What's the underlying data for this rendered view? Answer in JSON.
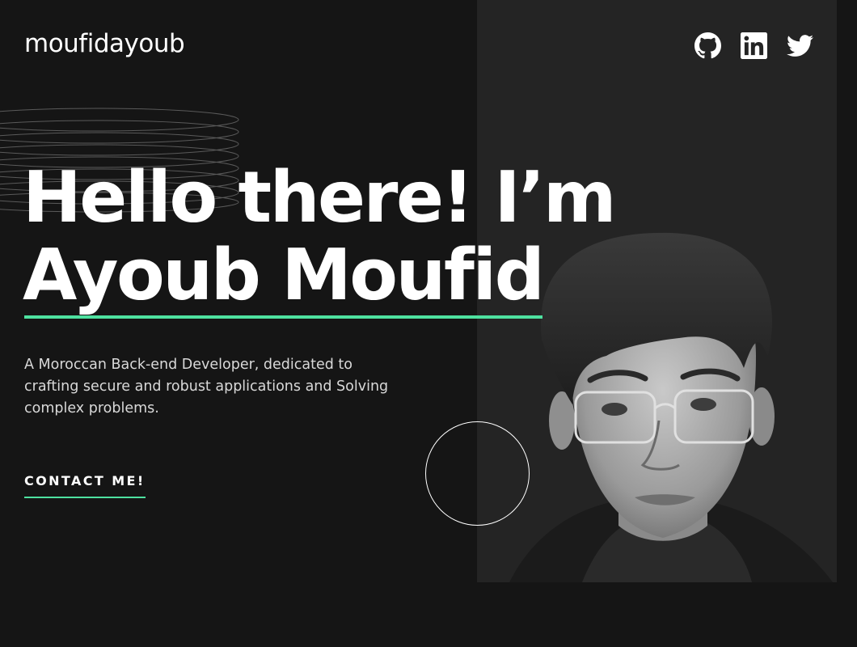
{
  "header": {
    "logo": "moufidayoub",
    "socials": [
      {
        "name": "github",
        "icon": "github-icon"
      },
      {
        "name": "linkedin",
        "icon": "linkedin-icon"
      },
      {
        "name": "twitter",
        "icon": "twitter-icon"
      }
    ]
  },
  "hero": {
    "greeting": "Hello there! I’m",
    "name": "Ayoub Moufid",
    "description": "A Moroccan Back-end Developer, dedicated to crafting secure and robust applications and Solving complex problems.",
    "cta_label": "CONTACT ME!"
  },
  "colors": {
    "background": "#151515",
    "panel": "#242424",
    "accent": "#4ee1a0",
    "text": "#ffffff",
    "muted": "#d9d9d9"
  },
  "images": {
    "portrait": "grayscale portrait photo"
  }
}
